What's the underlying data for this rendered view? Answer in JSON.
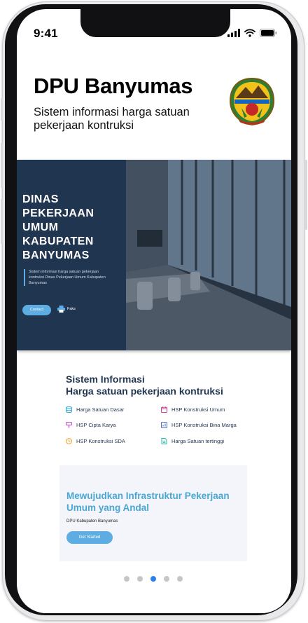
{
  "status_bar": {
    "time": "9:41"
  },
  "header": {
    "title": "DPU Banyumas",
    "subtitle": "Sistem informasi harga satuan pekerjaan kontruksi"
  },
  "hero": {
    "title": "DINAS PEKERJAAN UMUM KABUPATEN BANYUMAS",
    "description": "Sistem informasi harga satuan pekerjaan kontruksi Dinas Pekerjaan Umum Kabupaten Banyumas",
    "contact_label": "Contact",
    "faks_label": "Faks"
  },
  "services": {
    "title_line1": "Sistem Informasi",
    "title_line2": "Harga satuan pekerjaan kontruksi",
    "items": [
      {
        "label": "Harga Satuan Dasar",
        "icon": "database-icon",
        "color": "#2aa9c9"
      },
      {
        "label": "HSP Konstruksi Umum",
        "icon": "calendar-icon",
        "color": "#d63f8c"
      },
      {
        "label": "HSP Cipta Karya",
        "icon": "brush-icon",
        "color": "#c94fd9"
      },
      {
        "label": "HSP Konstruksi Bina Marga",
        "icon": "chart-icon",
        "color": "#4a6fd4"
      },
      {
        "label": "HSP Konstruksi SDA",
        "icon": "clock-icon",
        "color": "#f0a020"
      },
      {
        "label": "Harga Satuan tertinggi",
        "icon": "document-icon",
        "color": "#28b7a7"
      }
    ]
  },
  "cta": {
    "title": "Mewujudkan Infrastruktur Pekerjaan Umum yang Andal",
    "org": "DPU Kabupaten Banyumas",
    "button_label": "Get Started"
  },
  "pagination": {
    "count": 5,
    "active_index": 3
  },
  "colors": {
    "accent": "#5dade2",
    "navy": "#1f3550",
    "active_dot": "#2f80ed"
  }
}
